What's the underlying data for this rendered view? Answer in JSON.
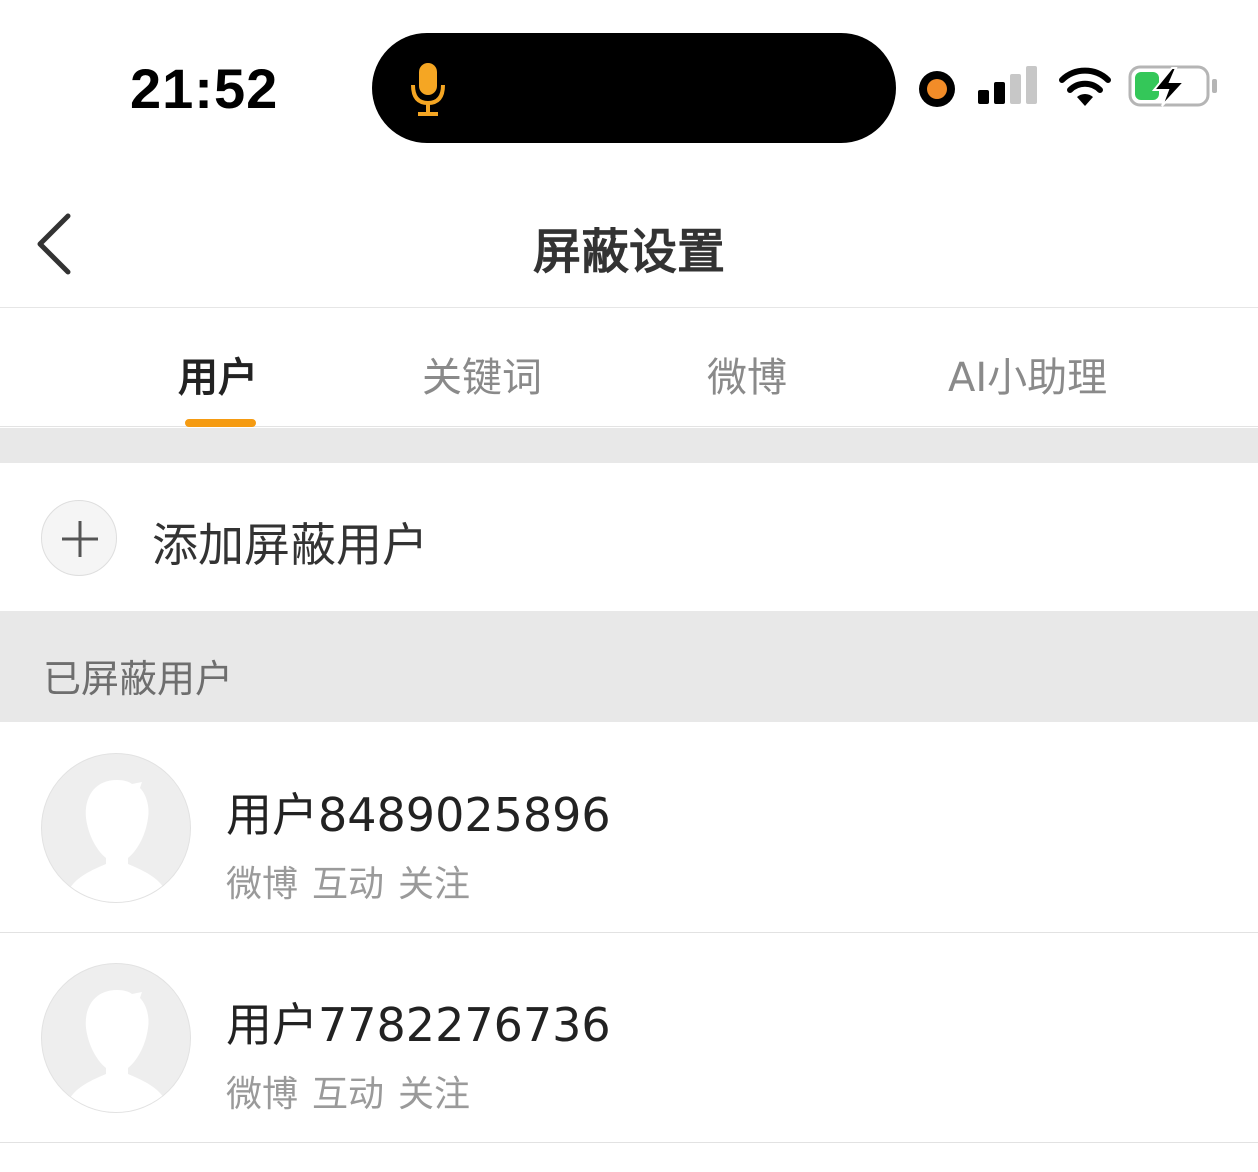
{
  "status_bar": {
    "time": "21:52",
    "icons": [
      "microphone-icon",
      "recording-dot",
      "cellular-signal-icon",
      "wifi-icon",
      "battery-charging-icon"
    ],
    "accent_color": "#f28c28"
  },
  "nav": {
    "title": "屏蔽设置",
    "back_icon": "chevron-left-icon"
  },
  "tabs": [
    {
      "label": "用户",
      "active": true
    },
    {
      "label": "关键词",
      "active": false
    },
    {
      "label": "微博",
      "active": false
    },
    {
      "label": "AI小助理",
      "active": false
    }
  ],
  "tab_indicator_color": "#f59b12",
  "add_row": {
    "label": "添加屏蔽用户",
    "icon": "plus-icon"
  },
  "section": {
    "title": "已屏蔽用户"
  },
  "blocked_users": [
    {
      "name": "用户8489025896",
      "tags": [
        "微博",
        "互动",
        "关注"
      ]
    },
    {
      "name": "用户7782276736",
      "tags": [
        "微博",
        "互动",
        "关注"
      ]
    }
  ]
}
